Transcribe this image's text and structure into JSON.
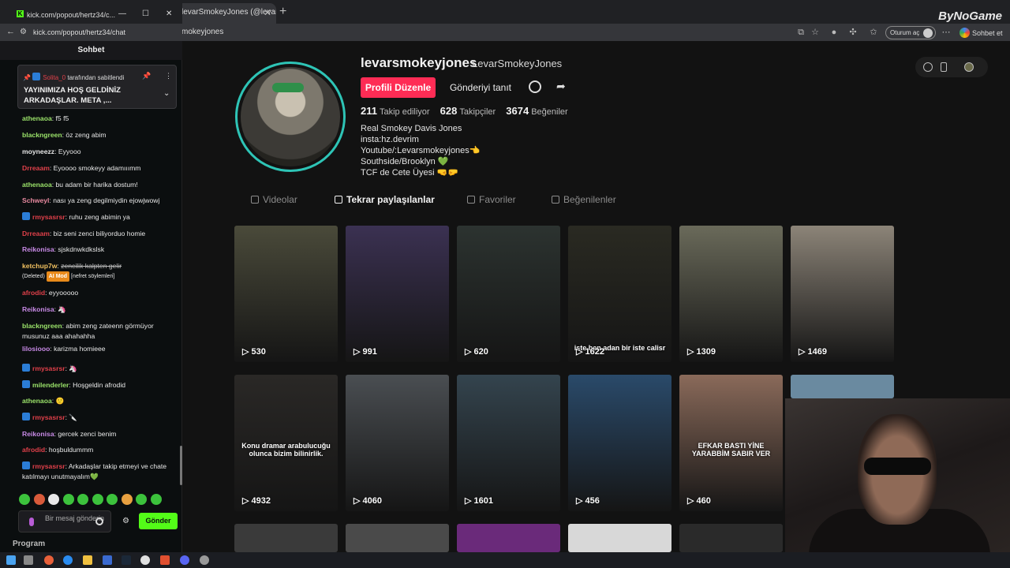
{
  "browser": {
    "tab_title": "levarSmokeyJones (@levarsm",
    "tab_close": "✕",
    "new_tab": "+",
    "url": "mokeyjones",
    "signin_label": "Oturum aç",
    "chat_label": "Sohbet et",
    "brand": "ByNoGame"
  },
  "popout": {
    "title": "kick.com/popout/hertz34/c...",
    "url": "kick.com/popout/hertz34/chat",
    "minimize": "—",
    "maximize": "☐",
    "close": "✕",
    "logo": "K"
  },
  "chat": {
    "header": "Sohbet",
    "pinned": {
      "pinner": "Solita_0",
      "pinned_by_suffix": "tarafından sabitlendi",
      "text": "YAYINIMIZA HOŞ GELDİNİZ ARKADAŞLAR. META ,..."
    },
    "messages": [
      {
        "user": "athenaoa",
        "color": "#9be36a",
        "text": "f5 f5"
      },
      {
        "user": "blackngreen",
        "color": "#9be36a",
        "text": "öz zeng abim"
      },
      {
        "user": "moyneezz",
        "color": "#e6e6e6",
        "text": "Eyyooo"
      },
      {
        "user": "Drreaam",
        "color": "#e0404a",
        "text": "Eyoooo smokeyy adamııımm"
      },
      {
        "user": "athenaoa",
        "color": "#9be36a",
        "text": "bu adam bir harika dostum!"
      },
      {
        "user": "Schweyl",
        "color": "#e88aa0",
        "text": "nası ya zeng degilmiydin ejowjwowj"
      },
      {
        "user": "rmysasrsr",
        "color": "#e0404a",
        "text": "ruhu zeng abimin ya",
        "badge": true
      },
      {
        "user": "Drreaam",
        "color": "#e0404a",
        "text": "biz seni zenci biliyorduo homie"
      },
      {
        "user": "Reikonisa",
        "color": "#c88ae6",
        "text": "sjskdnwkdkslsk"
      },
      {
        "user": "ketchup7w",
        "color": "#f0c060",
        "text": "zencilik kalpten gelir",
        "strike": true
      },
      {
        "user": "afrodid",
        "color": "#e0404a",
        "text": "eyyooooo"
      },
      {
        "user": "Reikonisa",
        "color": "#c88ae6",
        "text": "🦄"
      },
      {
        "user": "blackngreen",
        "color": "#9be36a",
        "text": "abim zeng zateenn görmüyor musunuz aaa ahahahha"
      },
      {
        "user": "lilosiooo",
        "color": "#c88ae6",
        "text": "karizma homieee"
      },
      {
        "user": "rmysasrsr",
        "color": "#e0404a",
        "text": "🦄",
        "badge": true
      },
      {
        "user": "milenderler",
        "color": "#9be36a",
        "text": "Hoşgeldin afrodid",
        "badge": true
      },
      {
        "user": "athenaoa",
        "color": "#9be36a",
        "text": "🙂"
      },
      {
        "user": "rmysasrsr",
        "color": "#e0404a",
        "text": "🔪",
        "badge": true
      },
      {
        "user": "Reikonisa",
        "color": "#c88ae6",
        "text": "gercek zenci benim"
      },
      {
        "user": "afrodid",
        "color": "#e0404a",
        "text": "hoşbuldummm"
      },
      {
        "user": "rmysasrsr",
        "color": "#e0404a",
        "text": "Arkadaşlar takip etmeyi ve chate katılmayı unutmayalım💚",
        "badge": true
      }
    ],
    "deleted_label": "(Deleted)",
    "ai_mod_label": "AI Mod",
    "deleted_reason": "[nefret söylemleri]",
    "input_placeholder": "Bir mesaj gönderin",
    "send_label": "Gönder",
    "program_label": "Program"
  },
  "profile": {
    "username": "levarsmokeyjones",
    "nickname": "LevarSmokeyJones",
    "edit_label": "Profili Düzenle",
    "promote_label": "Gönderiyi tanıt",
    "stats": [
      {
        "value": "211",
        "label": "Takip ediliyor"
      },
      {
        "value": "628",
        "label": "Takipçiler"
      },
      {
        "value": "3674",
        "label": "Beğeniler"
      }
    ],
    "bio": [
      "Real Smokey Davis Jones",
      "insta:hz.devrim",
      "Youtube/:Levarsmokeyjones👈",
      "Southside/Brooklyn 💚",
      "TCF de Cete Üyesi 🤜🤛"
    ],
    "tabs": [
      "Videolar",
      "Tekrar paylaşılanlar",
      "Favoriler",
      "Beğenilenler"
    ],
    "active_tab": 1
  },
  "videos": [
    {
      "views": "530",
      "color": "#4a4a3a"
    },
    {
      "views": "991",
      "color": "#3b3152"
    },
    {
      "views": "620",
      "color": "#2c3330"
    },
    {
      "views": "1622",
      "color": "#2a2a22",
      "caption": "iste ben adan bir iste calisr"
    },
    {
      "views": "1309",
      "color": "#6a6a5a"
    },
    {
      "views": "1469",
      "color": "#8c8478"
    },
    {
      "views": "4932",
      "color": "#2a2826",
      "caption": "Konu dramar arabulucuğu olunca bizim bilinirlik."
    },
    {
      "views": "4060",
      "color": "#4a4e52"
    },
    {
      "views": "1601",
      "color": "#34444e"
    },
    {
      "views": "456",
      "color": "#2a4a6a"
    },
    {
      "views": "460",
      "color": "#8a6a5a",
      "caption": "EFKAR BASTI YİNE YARABBİM SABIR VER"
    }
  ]
}
